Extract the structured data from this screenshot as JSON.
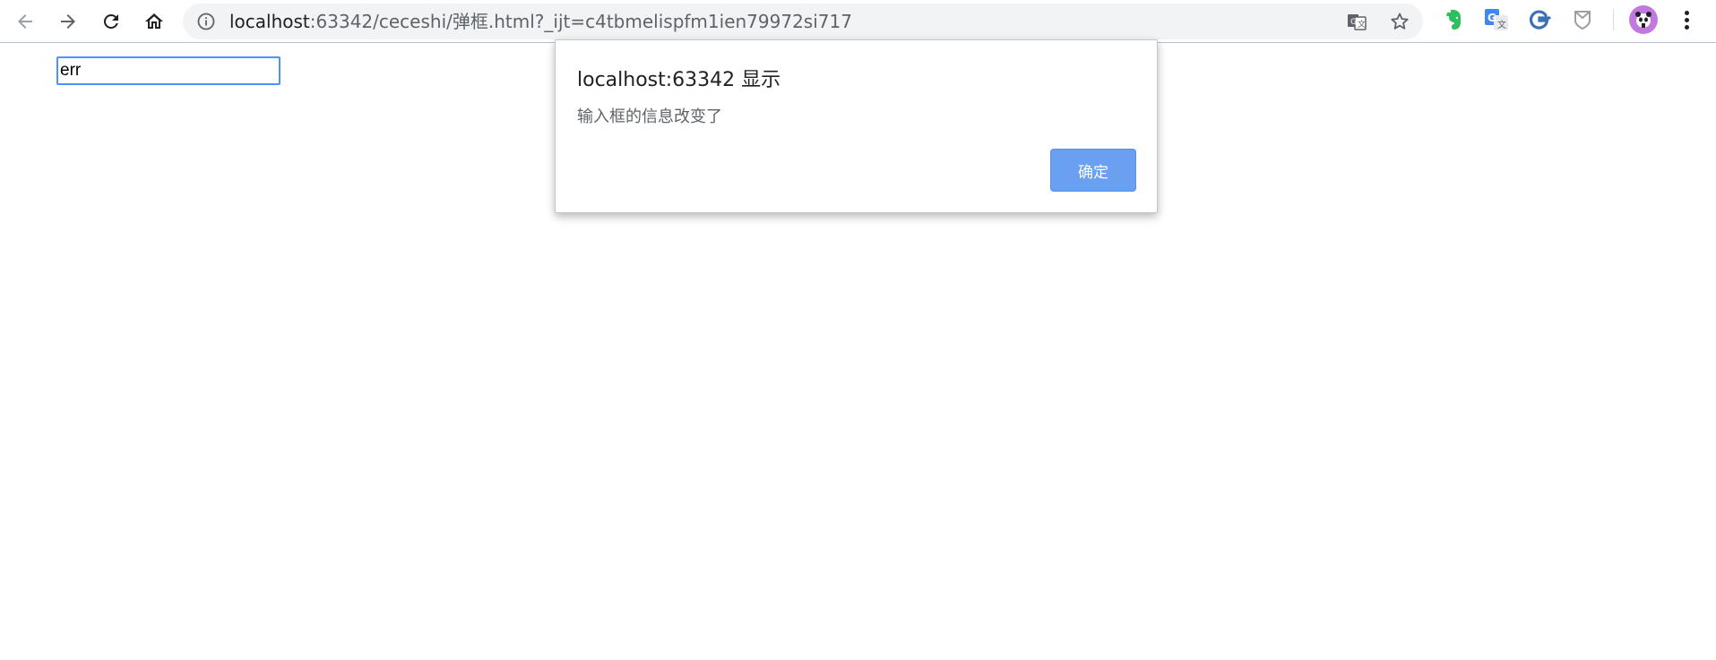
{
  "browser": {
    "url_host": "localhost",
    "url_rest": ":63342/ceceshi/弹框.html?_ijt=c4tbmelispfm1ien79972si717"
  },
  "page": {
    "input_value": "err"
  },
  "dialog": {
    "title": "localhost:63342 显示",
    "message": "输入框的信息改变了",
    "ok_label": "确定"
  },
  "colors": {
    "dialog_ok_bg": "#6a9ff1",
    "input_focus_border": "#4d90fe",
    "avatar_bg": "#c179e0",
    "evernote_green": "#2dbe60"
  }
}
